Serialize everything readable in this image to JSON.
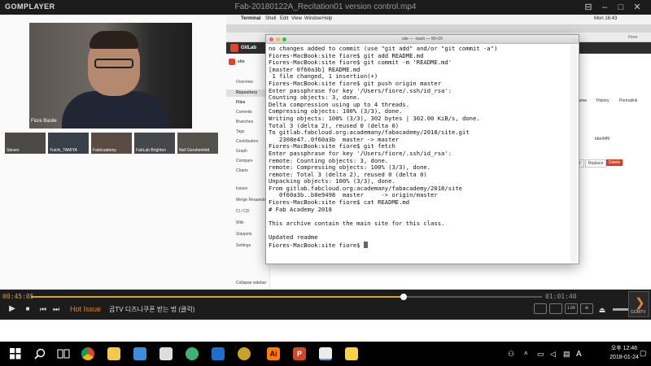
{
  "player": {
    "brand": "GOMPLAYER",
    "file_title": "Fab-20180122A_Recitation01  version  control.mp4",
    "current_time": "00:45:05",
    "total_time": "01:01:40",
    "progress": 0.73,
    "hot_label": "Hot Issue",
    "hot_text": "곰TV 디즈니쿠폰 받는 법 (클릭)",
    "buttons": {
      "b1": "",
      "b2": "",
      "b3": "1.0X"
    },
    "corner_label": "GOMTV"
  },
  "hangout": {
    "speaker_name": "Fiore Basile",
    "participants": [
      "Steven",
      "Yuichi_TAMIYA",
      "Fabricademy",
      "FabLab Brighton",
      "Neil Gershenfeld"
    ]
  },
  "mac": {
    "menu": [
      "Terminal",
      "Shell",
      "Edit",
      "View",
      "Window",
      "Help"
    ],
    "clock": "Mon 16:43",
    "user": "Fiore",
    "gitlab_label": "GitLab",
    "project": "site",
    "sidebar": [
      "Overview",
      "Repository",
      "Files",
      "Commits",
      "Branches",
      "Tags",
      "Contributors",
      "Graph",
      "Compare",
      "Charts",
      "Issues",
      "Merge Requests",
      "CI / CD",
      "Wiki",
      "Snippets",
      "Settings"
    ],
    "collapse_label": "Collapse sidebar",
    "right_tabs": [
      "Blame",
      "History",
      "Permalink"
    ],
    "commit_hash": "b6e94f9",
    "file_actions": [
      "Edit",
      "Replace",
      "Delete"
    ]
  },
  "terminal": {
    "title": "site — -bash — 90×29",
    "lines": [
      "no changes added to commit (use \"git add\" and/or \"git commit -a\")",
      "Fiores-MacBook:site fiore$ git add README.md",
      "Fiores-MacBook:site fiore$ git commit -m 'README.md'",
      "[master 0f60a3b] README.md",
      " 1 file changed, 1 insertion(+)",
      "Fiores-MacBook:site fiore$ git push origin master",
      "Enter passphrase for key '/Users/fiore/.ssh/id_rsa':",
      "Counting objects: 3, done.",
      "Delta compression using up to 4 threads.",
      "Compressing objects: 100% (3/3), done.",
      "Writing objects: 100% (3/3), 302 bytes | 302.00 KiB/s, done.",
      "Total 3 (delta 2), reused 0 (delta 0)",
      "To gitlab.fabcloud.org:academany/fabacademy/2018/site.git",
      "   2308e47..0f60a3b  master -> master",
      "Fiores-MacBook:site fiore$ git fetch",
      "Enter passphrase for key '/Users/fiore/.ssh/id_rsa':",
      "remote: Counting objects: 3, done.",
      "remote: Compressing objects: 100% (3/3), done.",
      "remote: Total 3 (delta 2), reused 0 (delta 0)",
      "Unpacking objects: 100% (3/3), done.",
      "From gitlab.fabcloud.org:academany/fabacademy/2018/site",
      "   0f60a3b..b0e9498  master     -> origin/master",
      "Fiores-MacBook:site fiore$ cat README.md",
      "# Fab Academy 2018",
      "",
      "This archive contain the main site for this class.",
      "",
      "Updated readme"
    ],
    "prompt": "Fiores-MacBook:site fiore$ "
  },
  "taskbar": {
    "ime": "A",
    "time": "오후 12:46",
    "date": "2018-01-24"
  }
}
